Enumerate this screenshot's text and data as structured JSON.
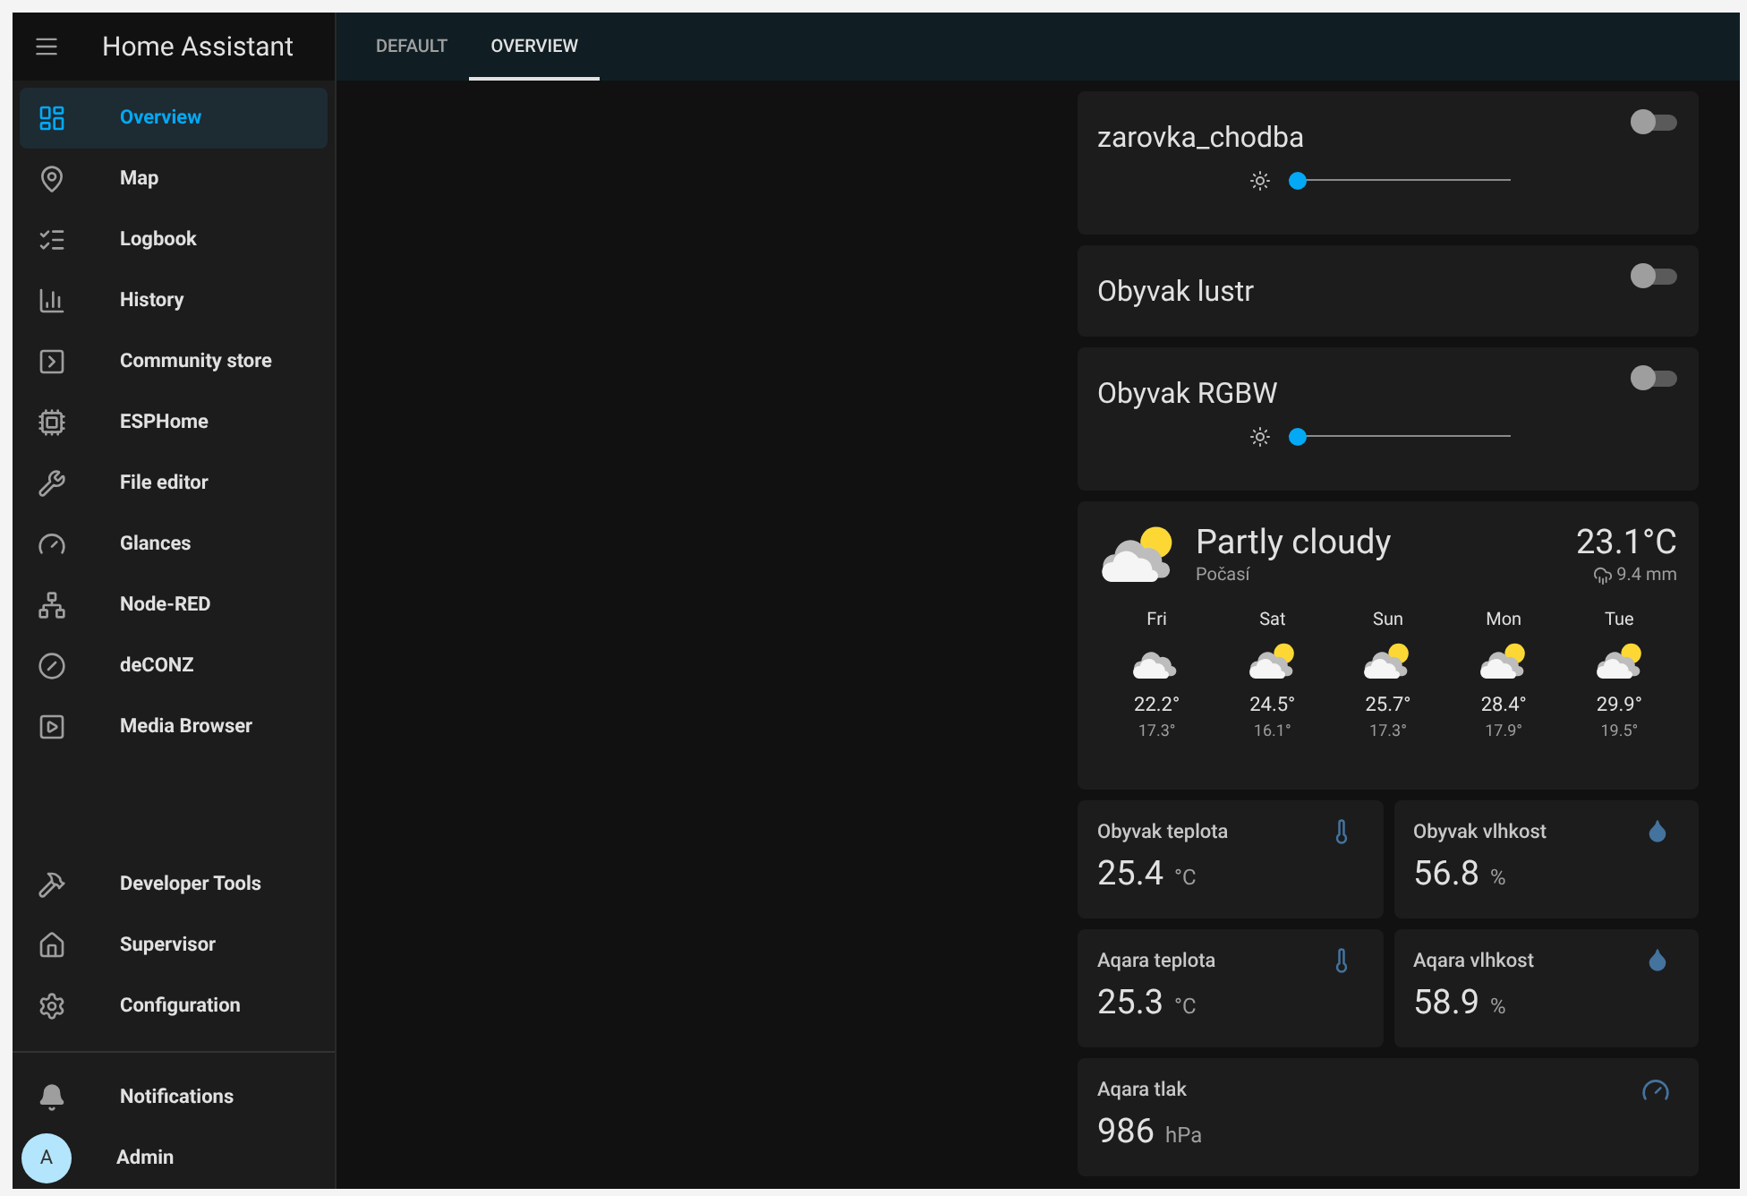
{
  "sidebar": {
    "title": "Home Assistant",
    "items": [
      {
        "label": "Overview",
        "kind": "dashboard",
        "selected": true
      },
      {
        "label": "Map",
        "kind": "map",
        "selected": false
      },
      {
        "label": "Logbook",
        "kind": "list",
        "selected": false
      },
      {
        "label": "History",
        "kind": "chart",
        "selected": false
      },
      {
        "label": "Community store",
        "kind": "store",
        "selected": false
      },
      {
        "label": "ESPHome",
        "kind": "chip",
        "selected": false
      },
      {
        "label": "File editor",
        "kind": "wrench",
        "selected": false
      },
      {
        "label": "Glances",
        "kind": "gauge",
        "selected": false
      },
      {
        "label": "Node-RED",
        "kind": "tree",
        "selected": false
      },
      {
        "label": "deCONZ",
        "kind": "zigbee",
        "selected": false
      },
      {
        "label": "Media Browser",
        "kind": "media",
        "selected": false
      }
    ],
    "bottom_items": [
      {
        "label": "Developer Tools",
        "kind": "hammer",
        "selected": false
      },
      {
        "label": "Supervisor",
        "kind": "house",
        "selected": false
      },
      {
        "label": "Configuration",
        "kind": "gear",
        "selected": false
      }
    ],
    "notifications": "Notifications",
    "user": {
      "initial": "A",
      "name": "Admin"
    }
  },
  "tabs": [
    {
      "label": "DEFAULT",
      "selected": false
    },
    {
      "label": "OVERVIEW",
      "selected": true
    }
  ],
  "lights": [
    {
      "name": "zarovka_chodba",
      "on": false,
      "brightness": true,
      "level": 0.0
    },
    {
      "name": "Obyvak lustr",
      "on": false,
      "brightness": false
    },
    {
      "name": "Obyvak RGBW",
      "on": false,
      "brightness": true,
      "level": 0.0
    }
  ],
  "weather": {
    "condition": "Partly cloudy",
    "kind": "partlycloudy",
    "name": "Počasí",
    "temperature": "23.1°C",
    "precipitation": "9.4 mm",
    "forecast": [
      {
        "day": "Fri",
        "kind": "cloudy",
        "high": "22.2°",
        "low": "17.3°"
      },
      {
        "day": "Sat",
        "kind": "partlycloudy",
        "high": "24.5°",
        "low": "16.1°"
      },
      {
        "day": "Sun",
        "kind": "partlycloudy",
        "high": "25.7°",
        "low": "17.3°"
      },
      {
        "day": "Mon",
        "kind": "partlycloudy",
        "high": "28.4°",
        "low": "17.9°"
      },
      {
        "day": "Tue",
        "kind": "partlycloudy",
        "high": "29.9°",
        "low": "19.5°"
      }
    ]
  },
  "sensors": [
    {
      "name": "Obyvak teplota",
      "kind": "temperature",
      "value": "25.4",
      "unit": "°C"
    },
    {
      "name": "Obyvak vlhkost",
      "kind": "humidity",
      "value": "56.8",
      "unit": "%"
    },
    {
      "name": "Aqara teplota",
      "kind": "temperature",
      "value": "25.3",
      "unit": "°C"
    },
    {
      "name": "Aqara vlhkost",
      "kind": "humidity",
      "value": "58.9",
      "unit": "%"
    },
    {
      "name": "Aqara tlak",
      "kind": "pressure",
      "value": "986",
      "unit": "hPa",
      "wide": true
    }
  ]
}
